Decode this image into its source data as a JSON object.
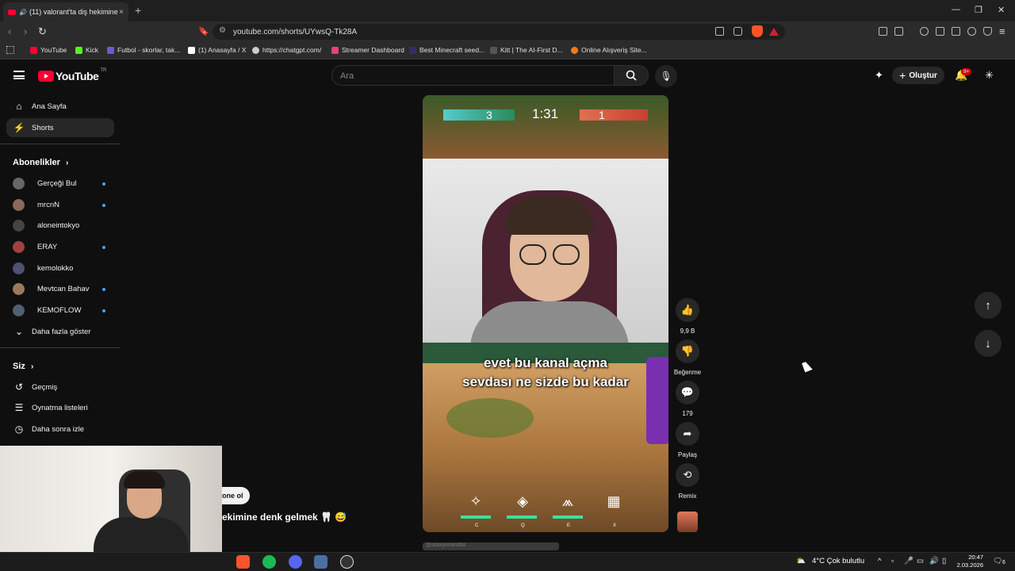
{
  "browser": {
    "tab_title": "(11) valorant'ta diş hekimine",
    "url": "youtube.com/shorts/UYwsQ-Tk28A",
    "bookmarks": [
      {
        "label": "YouTube",
        "color": "#ff0033"
      },
      {
        "label": "Kick",
        "color": "#53fc18"
      },
      {
        "label": "Futbol - skorlar, tak...",
        "color": "#6a5acd"
      },
      {
        "label": "(1) Anasayfa / X",
        "color": "#ffffff"
      },
      {
        "label": "https://chatgpt.com/",
        "color": "#cccccc"
      },
      {
        "label": "Streamer Dashboard",
        "color": "#e0457b"
      },
      {
        "label": "Best Minecraft seed...",
        "color": "#3b2a6a"
      },
      {
        "label": "Kitt | The AI-First D...",
        "color": "#222222"
      },
      {
        "label": "Online Alışveriş Site...",
        "color": "#f27a1a"
      }
    ]
  },
  "youtube": {
    "logo_text": "YouTube",
    "logo_sup": "TR",
    "search_placeholder": "Ara",
    "create_label": "Oluştur",
    "notif_badge": "9+"
  },
  "sidebar": {
    "main": [
      {
        "label": "Ana Sayfa",
        "icon": "home-icon"
      },
      {
        "label": "Shorts",
        "icon": "shorts-icon",
        "active": true
      }
    ],
    "subs_header": "Abonelikler",
    "subscriptions": [
      {
        "label": "Gerçeği Bul",
        "color": "#666666",
        "dot": true
      },
      {
        "label": "mrcnN",
        "color": "#8a6a5a",
        "dot": true
      },
      {
        "label": "aloneintokyo",
        "color": "#444444",
        "dot": false
      },
      {
        "label": "ERAY",
        "color": "#a04040",
        "dot": true
      },
      {
        "label": "kemolokko",
        "color": "#505070",
        "dot": false
      },
      {
        "label": "Mevtcan Bahav",
        "color": "#9a7a5a",
        "dot": true
      },
      {
        "label": "KEMOFLOW",
        "color": "#506070",
        "dot": true
      }
    ],
    "show_more": "Daha fazla göster",
    "you_header": "Siz",
    "you_items": [
      {
        "label": "Geçmiş",
        "icon": "history-icon"
      },
      {
        "label": "Oynatma listeleri",
        "icon": "playlist-icon"
      },
      {
        "label": "Daha sonra izle",
        "icon": "watch-later-icon"
      }
    ]
  },
  "video": {
    "hud_time": "1:31",
    "hud_score_left": "3",
    "hud_score_right": "1",
    "caption_line1": "evet bu kanal açma",
    "caption_line2": "sevdası ne sizde bu kadar",
    "ability_keys": [
      "C",
      "Q",
      "E",
      "X"
    ],
    "subscribe_partial": "one ol",
    "title_partial": "ekimine denk gelmek 🦷 😅",
    "channel_partial": "@ataxyonandits"
  },
  "actions": {
    "like_count": "9,9 B",
    "dislike_label": "Beğenme",
    "comment_count": "179",
    "share_label": "Paylaş",
    "remix_label": "Remix"
  },
  "taskbar": {
    "weather": "4°C  Çok bulutlu",
    "time": "20:47",
    "date": "2.03.2026",
    "notif_count": "6"
  }
}
